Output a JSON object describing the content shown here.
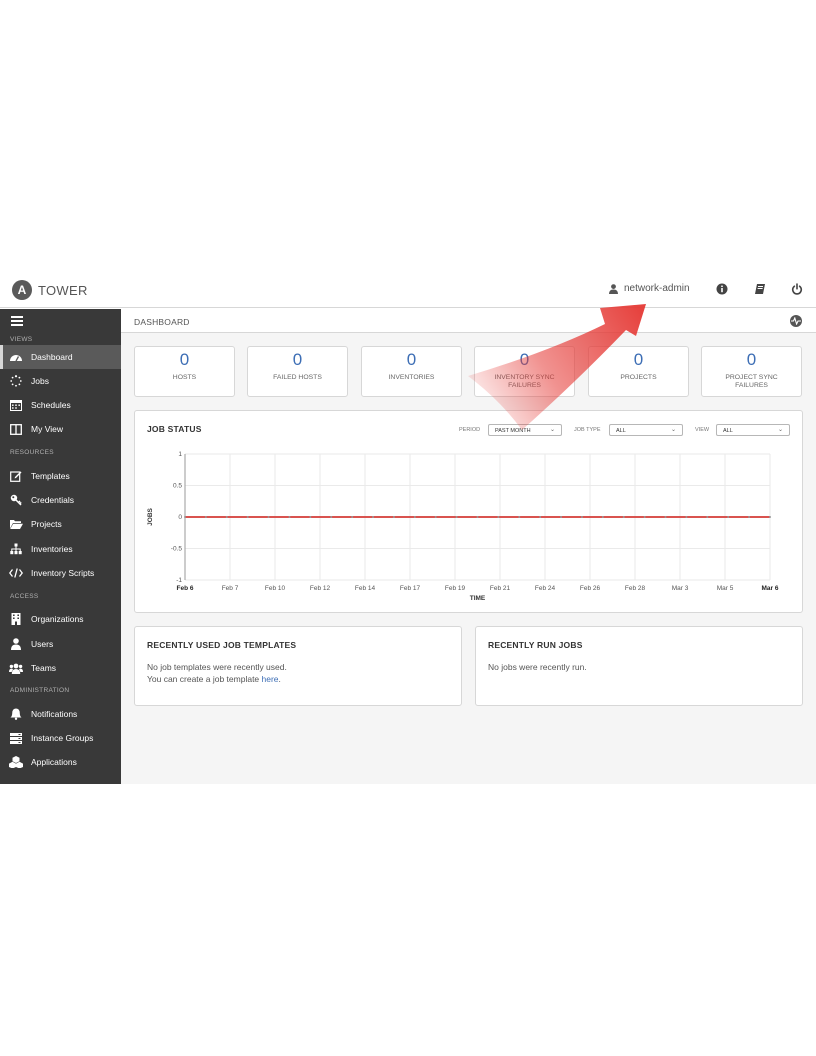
{
  "header": {
    "logo_letter": "A",
    "app_name": "TOWER",
    "username": "network-admin"
  },
  "sidebar": {
    "sections": {
      "views": "VIEWS",
      "resources": "RESOURCES",
      "access": "ACCESS",
      "administration": "ADMINISTRATION"
    },
    "items": [
      {
        "label": "Dashboard",
        "icon": "dashboard-icon",
        "active": true
      },
      {
        "label": "Jobs",
        "icon": "spinner-icon"
      },
      {
        "label": "Schedules",
        "icon": "calendar-icon"
      },
      {
        "label": "My View",
        "icon": "columns-icon"
      },
      {
        "label": "Templates",
        "icon": "edit-icon"
      },
      {
        "label": "Credentials",
        "icon": "key-icon"
      },
      {
        "label": "Projects",
        "icon": "folder-icon"
      },
      {
        "label": "Inventories",
        "icon": "sitemap-icon"
      },
      {
        "label": "Inventory Scripts",
        "icon": "code-icon"
      },
      {
        "label": "Organizations",
        "icon": "building-icon"
      },
      {
        "label": "Users",
        "icon": "user-icon"
      },
      {
        "label": "Teams",
        "icon": "users-icon"
      },
      {
        "label": "Notifications",
        "icon": "bell-icon"
      },
      {
        "label": "Instance Groups",
        "icon": "server-icon"
      },
      {
        "label": "Applications",
        "icon": "cubes-icon"
      }
    ]
  },
  "breadcrumb": "DASHBOARD",
  "counts": [
    {
      "value": "0",
      "label": "HOSTS"
    },
    {
      "value": "0",
      "label": "FAILED HOSTS"
    },
    {
      "value": "0",
      "label": "INVENTORIES"
    },
    {
      "value": "0",
      "label": "INVENTORY SYNC FAILURES"
    },
    {
      "value": "0",
      "label": "PROJECTS"
    },
    {
      "value": "0",
      "label": "PROJECT SYNC FAILURES"
    }
  ],
  "job_status": {
    "title": "JOB STATUS",
    "period_label": "PERIOD",
    "period_value": "PAST MONTH",
    "job_type_label": "JOB TYPE",
    "job_type_value": "ALL",
    "view_label": "VIEW",
    "view_value": "ALL"
  },
  "chart_data": {
    "type": "line",
    "xlabel": "TIME",
    "ylabel": "JOBS",
    "ylim": [
      -1,
      1
    ],
    "y_ticks": [
      "1",
      "0.5",
      "0",
      "-0.5",
      "-1"
    ],
    "x_ticks": [
      "Feb 6",
      "Feb 7",
      "Feb 10",
      "Feb 12",
      "Feb 14",
      "Feb 17",
      "Feb 19",
      "Feb 21",
      "Feb 24",
      "Feb 26",
      "Feb 28",
      "Mar 3",
      "Mar 5",
      "Mar 6"
    ],
    "bold_ticks": [
      "Feb 6",
      "Mar 6"
    ],
    "grid": true,
    "series": [
      {
        "color": "#d9534f",
        "values": [
          0,
          0,
          0,
          0,
          0,
          0,
          0,
          0,
          0,
          0,
          0,
          0,
          0,
          0,
          0,
          0,
          0,
          0,
          0,
          0,
          0,
          0,
          0,
          0,
          0,
          0,
          0,
          0,
          0
        ]
      }
    ]
  },
  "recent_templates": {
    "title": "RECENTLY USED JOB TEMPLATES",
    "line1": "No job templates were recently used.",
    "line2_prefix": "You can create a job template ",
    "line2_link": "here",
    "line2_suffix": "."
  },
  "recent_jobs": {
    "title": "RECENTLY RUN JOBS",
    "empty": "No jobs were recently run."
  },
  "colors": {
    "sidebar_bg": "#393939",
    "accent_blue": "#3d6eb5",
    "line_red": "#d9534f",
    "annotation_arrow": "#e53935"
  }
}
